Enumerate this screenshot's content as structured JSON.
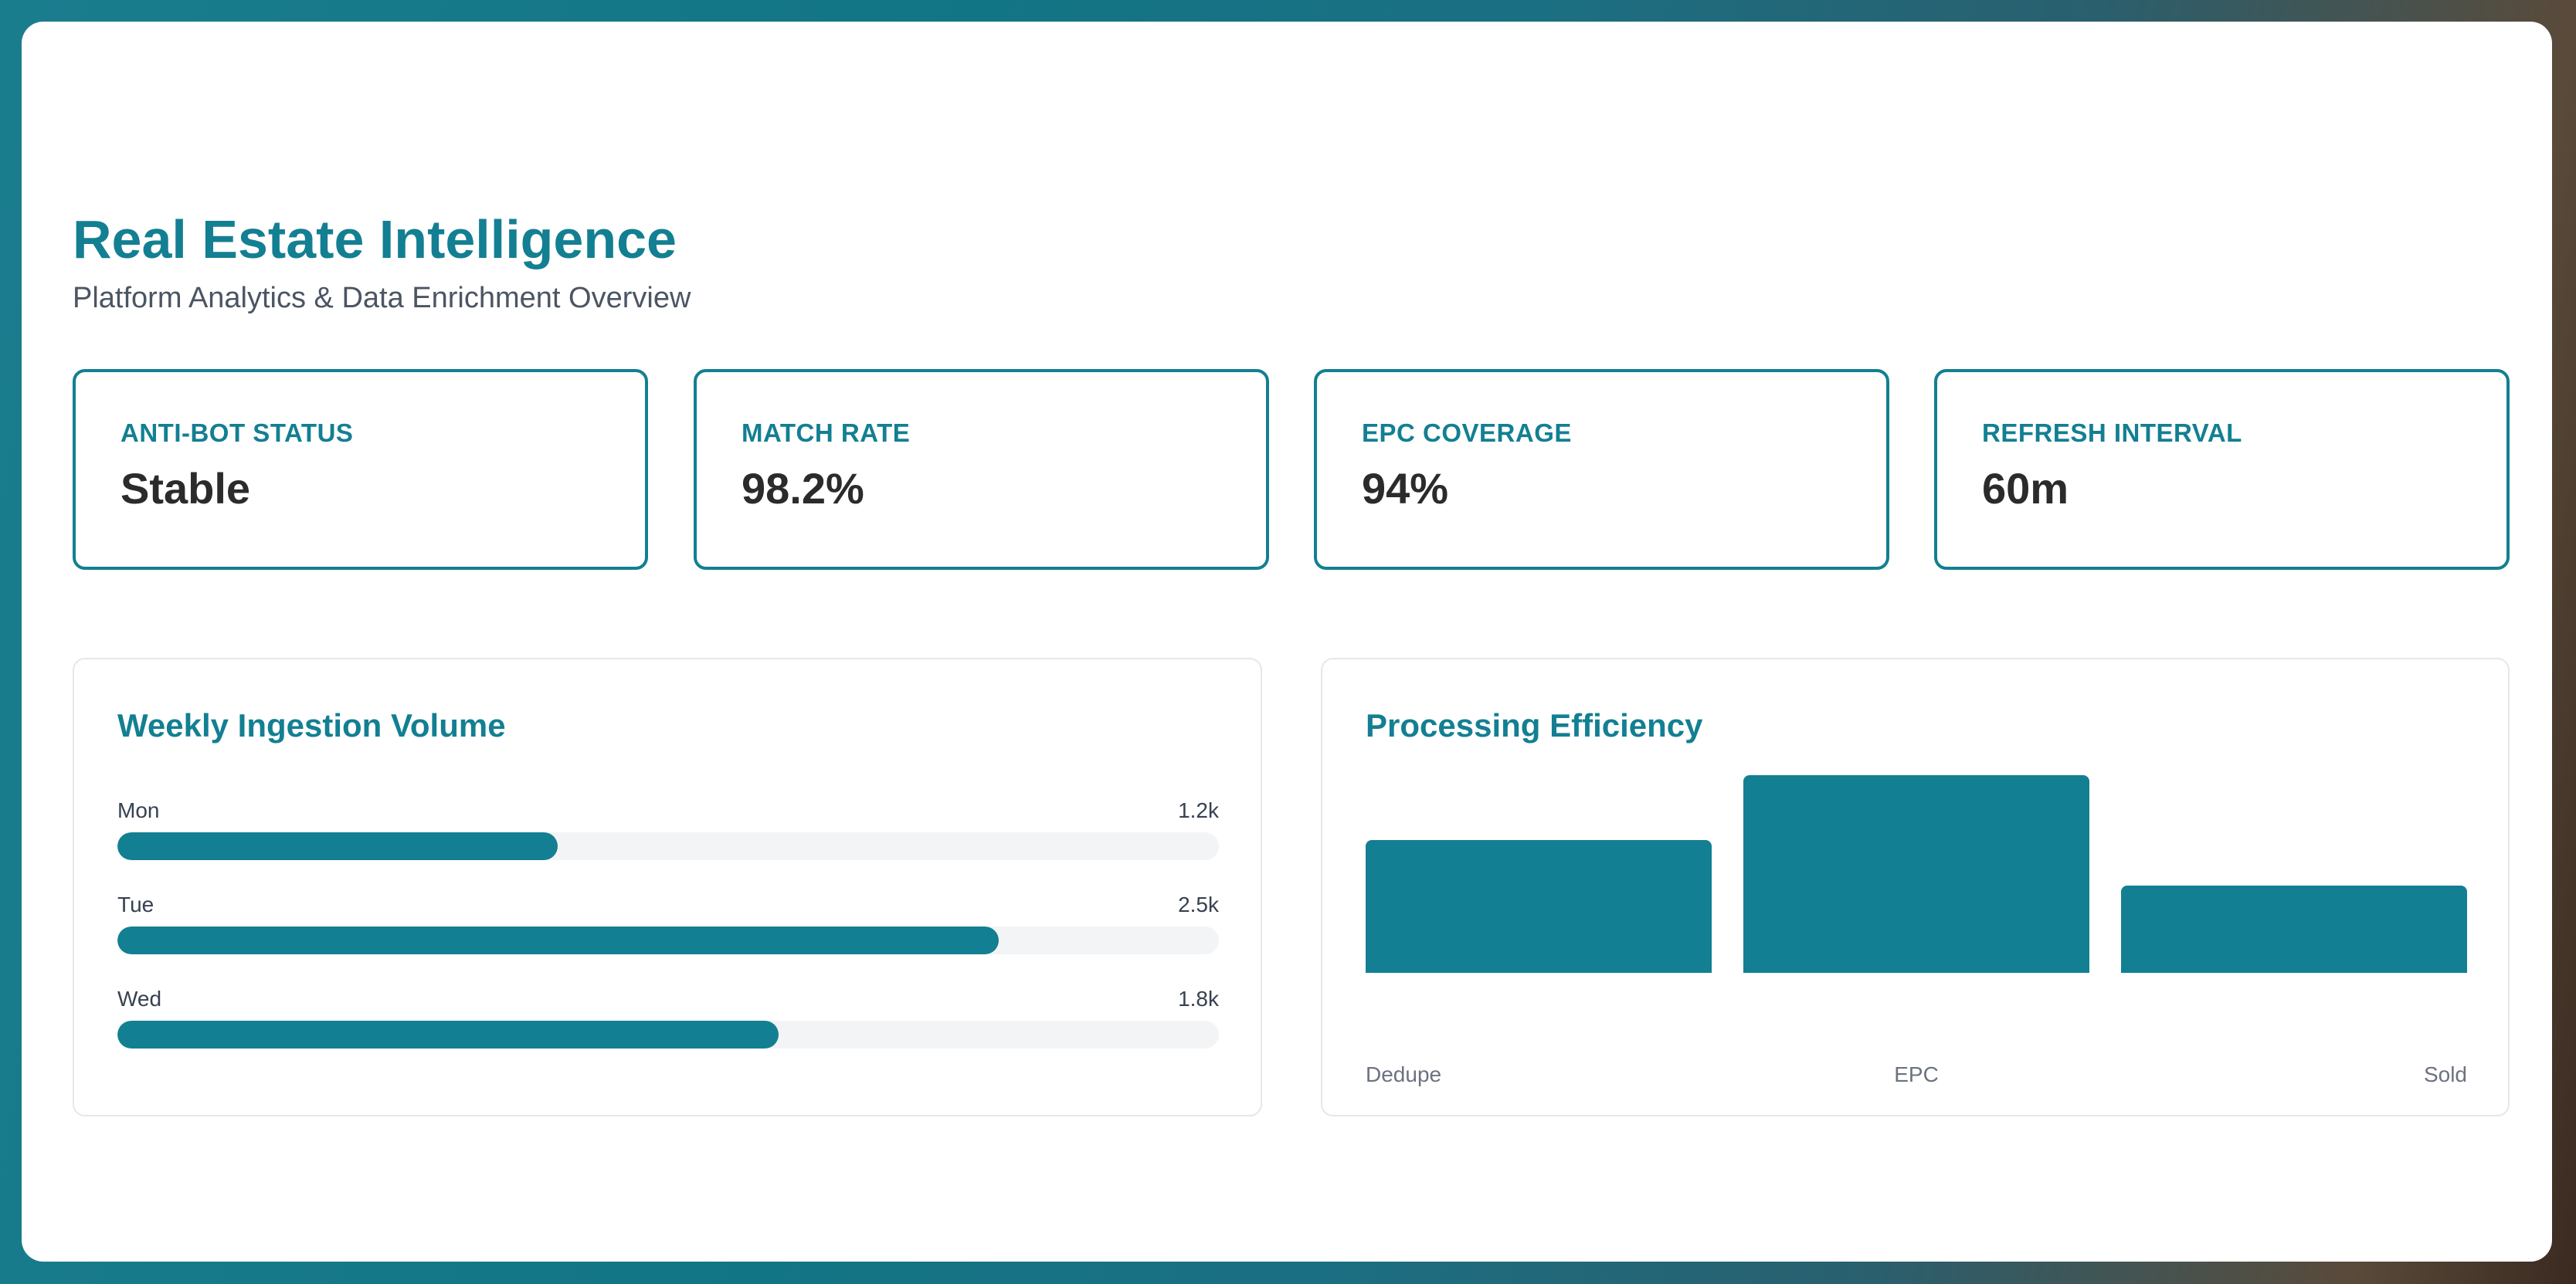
{
  "header": {
    "title": "Real Estate Intelligence",
    "subtitle": "Platform Analytics & Data Enrichment Overview"
  },
  "stats": [
    {
      "label": "ANTI-BOT STATUS",
      "value": "Stable"
    },
    {
      "label": "MATCH RATE",
      "value": "98.2%"
    },
    {
      "label": "EPC COVERAGE",
      "value": "94%"
    },
    {
      "label": "REFRESH INTERVAL",
      "value": "60m"
    }
  ],
  "ingestion": {
    "title": "Weekly Ingestion Volume",
    "rows": [
      {
        "day": "Mon",
        "value": "1.2k",
        "fill_pct": 40
      },
      {
        "day": "Tue",
        "value": "2.5k",
        "fill_pct": 80
      },
      {
        "day": "Wed",
        "value": "1.8k",
        "fill_pct": 60
      }
    ]
  },
  "efficiency": {
    "title": "Processing Efficiency",
    "chart_data": {
      "type": "bar",
      "categories": [
        "Dedupe",
        "EPC",
        "Sold"
      ],
      "values": [
        67,
        100,
        44
      ],
      "ylim": [
        0,
        100
      ]
    }
  },
  "colors": {
    "accent": "#137f92",
    "track": "#f3f4f6"
  }
}
